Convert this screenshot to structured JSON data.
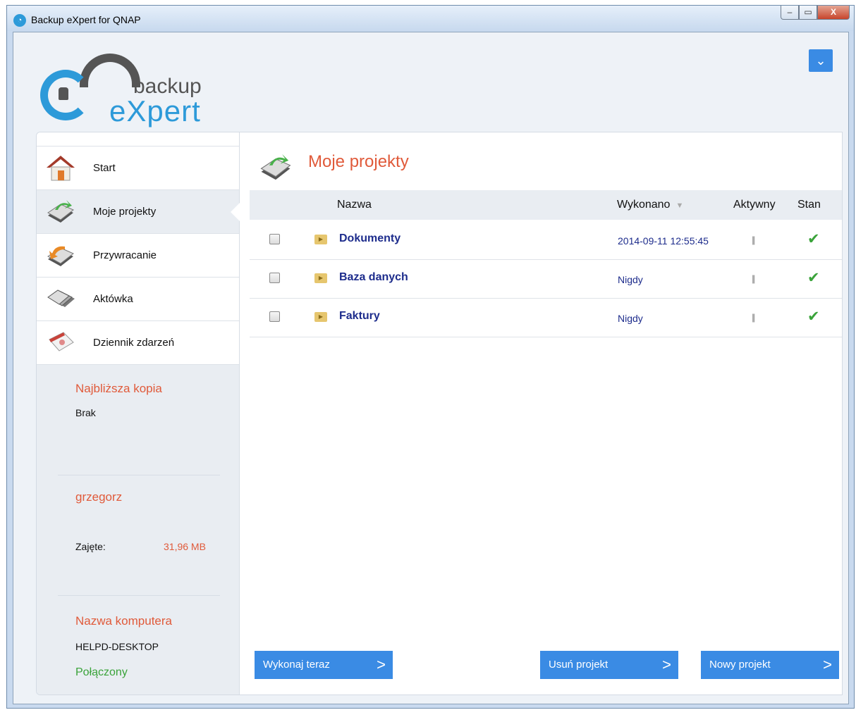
{
  "window": {
    "title": "Backup eXpert for QNAP",
    "minimize_glyph": "‒",
    "maximize_glyph": "▭",
    "close_glyph": "X"
  },
  "logo": {
    "line1": "backup",
    "line2": "eXpert"
  },
  "top_menu_glyph": "⌄",
  "sidebar": {
    "items": [
      {
        "label": "Start",
        "icon": "home-icon"
      },
      {
        "label": "Moje projekty",
        "icon": "projects-icon"
      },
      {
        "label": "Przywracanie",
        "icon": "restore-icon"
      },
      {
        "label": "Aktówka",
        "icon": "briefcase-icon"
      },
      {
        "label": "Dziennik zdarzeń",
        "icon": "calendar-icon"
      }
    ],
    "next_copy_title": "Najbliższa kopia",
    "next_copy_value": "Brak",
    "user_name": "grzegorz",
    "used_label": "Zajęte:",
    "used_value": "31,96 MB",
    "computer_title": "Nazwa komputera",
    "computer_name": "HELPD-DESKTOP",
    "connection_status": "Połączony"
  },
  "content": {
    "title": "Moje projekty",
    "columns": {
      "name": "Nazwa",
      "executed": "Wykonano",
      "sort_glyph": "▼",
      "active": "Aktywny",
      "status": "Stan"
    },
    "rows": [
      {
        "name": "Dokumenty",
        "executed": "2014-09-11 12:55:45",
        "active_glyph": "||",
        "status_glyph": "✔"
      },
      {
        "name": "Baza danych",
        "executed": "Nigdy",
        "active_glyph": "||",
        "status_glyph": "✔"
      },
      {
        "name": "Faktury",
        "executed": "Nigdy",
        "active_glyph": "||",
        "status_glyph": "✔"
      }
    ],
    "buttons": {
      "run_now": "Wykonaj teraz",
      "delete": "Usuń projekt",
      "new": "Nowy projekt",
      "chevron": ">"
    }
  },
  "colors": {
    "accent_blue": "#3a8be4",
    "title_red": "#e05a3a",
    "link_navy": "#1d2c8c",
    "ok_green": "#3aa33a"
  }
}
